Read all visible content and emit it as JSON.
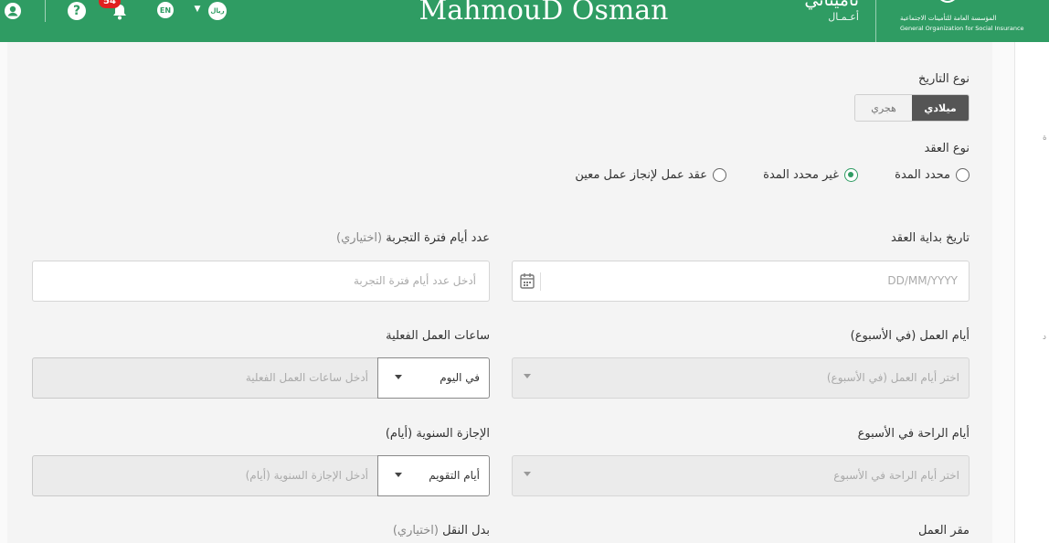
{
  "header": {
    "notifications_count": "54",
    "lang_label": "EN",
    "currency_label": "ريال",
    "user_name": "MahmouD Osman",
    "brand_main": "تأميناتي",
    "brand_sub": "أعـمـال",
    "org_name_ar": "المؤسسة العامة للتأمينات الاجتماعية",
    "org_name_en": "General Organization for Social Insurance",
    "bg_color": "#2f9c63"
  },
  "right_strip": {
    "chars": [
      "ة",
      "د"
    ]
  },
  "form": {
    "date_type_label": "نوع التاريخ",
    "date_type_options": {
      "gregorian": "ميلادي",
      "hijri": "هجري"
    },
    "contract_type_label": "نوع العقد",
    "contract_options": {
      "fixed": "محدد المدة",
      "unlimited": "غير محدد المدة",
      "specific_work": "عقد عمل لإنجاز عمل معين"
    },
    "contract_selected": "unlimited",
    "start_date_label": "تاريخ بداية العقد",
    "start_date_placeholder": "DD/MM/YYYY",
    "probation_label": "عدد أيام فترة التجربة",
    "probation_optional": "(اختياري)",
    "probation_placeholder": "أدخل عدد أيام فترة التجربة",
    "work_days_label": "أيام العمل (في الأسبوع)",
    "work_days_placeholder": "اختر أيام العمل (في الأسبوع)",
    "actual_hours_label": "ساعات العمل الفعلية",
    "actual_hours_placeholder": "أدخل ساعات العمل الفعلية",
    "actual_hours_unit": "في اليوم",
    "rest_days_label": "أيام الراحة في الأسبوع",
    "rest_days_placeholder": "اختر أيام الراحة في الأسبوع",
    "annual_leave_label": "الإجازة السنوية (أيام)",
    "annual_leave_placeholder": "أدخل الإجازة السنوية (أيام)",
    "annual_leave_unit": "أيام التقويم",
    "work_location_label": "مقر العمل",
    "transport_label": "بدل النقل",
    "transport_optional": "(اختياري)"
  }
}
